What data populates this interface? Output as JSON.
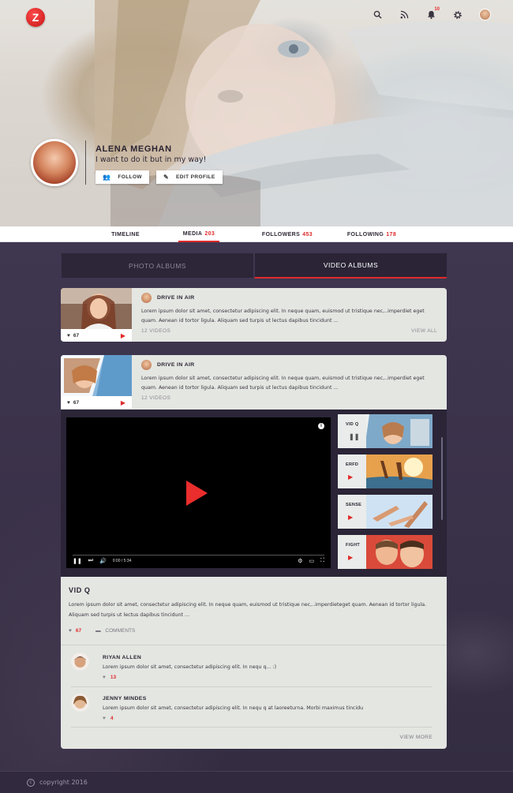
{
  "app": {
    "logo_letter": "Z"
  },
  "header_icons": [
    "search-icon",
    "rss-icon",
    "bell-icon",
    "gear-icon",
    "avatar"
  ],
  "notification_count": "10",
  "profile": {
    "name": "ALENA MEGHAN",
    "tagline": "I want to do it but in my way!",
    "follow_label": "FOLLOW",
    "edit_label": "EDIT PROFILE"
  },
  "tabs": [
    {
      "label": "TIMELINE",
      "count": ""
    },
    {
      "label": "MEDIA",
      "count": "203"
    },
    {
      "label": "FOLLOWERS",
      "count": "453"
    },
    {
      "label": "FOLLOWING",
      "count": "178"
    }
  ],
  "subtabs": {
    "photo": "PHOTO ALBUMS",
    "video": "VIDEO ALBUMS"
  },
  "album1": {
    "title": "DRIVE IN AIR",
    "text": "Lorem ipsum dolor sit amet, consectetur adipiscing elit. In neque quam, euismod ut tristique nec,..imperdiet eget quam. Aenean id tortor ligula. Aliquam sed turpis ut lectus dapibus tincidunt ...",
    "count": "12 VIDEOS",
    "likes": "67",
    "view_all": "VIEW ALL"
  },
  "album2": {
    "title": "DRIVE IN AIR",
    "text": "Lorem ipsum dolor sit amet, consectetur adipiscing elit. In neque quam, euismod ut tristique nec,..imperdiet eget quam. Aenean id tortor ligula. Aliquam sed turpis ut lectus dapibus tincidunt ...",
    "count": "12 VIDEOS",
    "likes": "67"
  },
  "player": {
    "time": "0:00 / 5:34"
  },
  "playlist": [
    {
      "label": "VID Q"
    },
    {
      "label": "ERFD"
    },
    {
      "label": "SENSE"
    },
    {
      "label": "FIGHT"
    }
  ],
  "video": {
    "title": "VID Q",
    "text": "Lorem ipsum dolor sit amet, consectetur adipiscing elit. In neque quam, euismod ut tristique nec,..imperdieteget quam. Aenean id tortor ligula. Aliquam sed turpis ut lectus dapibus tincidunt ...",
    "likes": "67",
    "comments_label": "COMMENTS"
  },
  "comments": [
    {
      "name": "RIYAN ALLEN",
      "text": "Lorem ipsum dolor sit amet, consectetur adipiscing elit. In nequ q... :)",
      "likes": "13"
    },
    {
      "name": "JENNY MINDES",
      "text": "Lorem ipsum dolor sit amet, consectetur adipiscing elit. In nequ q at laoreeturna. Morbi maximus tincidu",
      "likes": "4"
    }
  ],
  "view_more": "VIEW MORE",
  "footer": {
    "copyright": "copyright 2016"
  },
  "colors": {
    "accent": "#e02a2a",
    "dark_bg": "#3b3348",
    "card_bg": "#e4e6e2"
  }
}
